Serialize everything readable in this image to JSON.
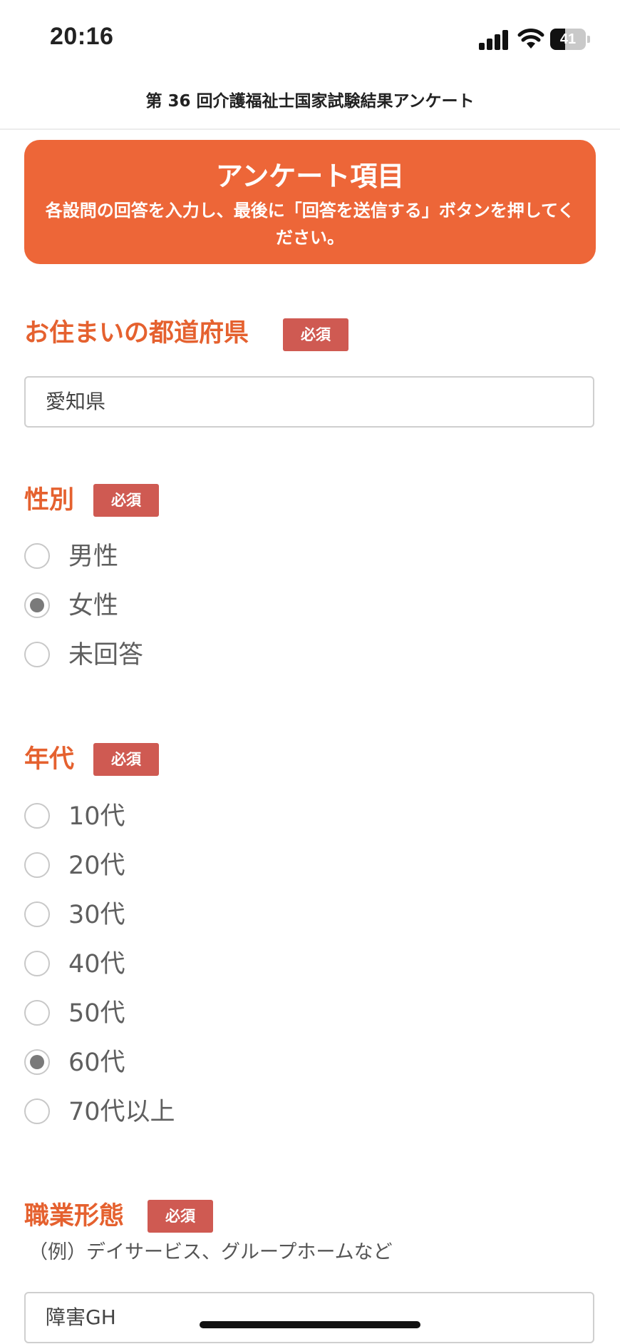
{
  "status_bar": {
    "time": "20:16",
    "battery": "41",
    "battery_level": 0.41
  },
  "header": {
    "title": "第 36 回介護福祉士国家試験結果アンケート"
  },
  "banner": {
    "title": "アンケート項目",
    "text": "各設問の回答を入力し、最後に「回答を送信する」ボタンを押してください。"
  },
  "questions": {
    "prefecture": {
      "label": "お住まいの都道府県",
      "required": "必須",
      "value": "愛知県"
    },
    "gender": {
      "label": "性別",
      "required": "必須",
      "options": [
        {
          "label": "男性",
          "checked": false
        },
        {
          "label": "女性",
          "checked": true
        },
        {
          "label": "未回答",
          "checked": false
        }
      ]
    },
    "age": {
      "label": "年代",
      "required": "必須",
      "options": [
        {
          "label": "10代",
          "checked": false
        },
        {
          "label": "20代",
          "checked": false
        },
        {
          "label": "30代",
          "checked": false
        },
        {
          "label": "40代",
          "checked": false
        },
        {
          "label": "50代",
          "checked": false
        },
        {
          "label": "60代",
          "checked": true
        },
        {
          "label": "70代以上",
          "checked": false
        }
      ]
    },
    "job": {
      "label": "職業形態",
      "required": "必須",
      "hint": "（例）デイサービス、グループホームなど",
      "value": "障害GH"
    }
  }
}
